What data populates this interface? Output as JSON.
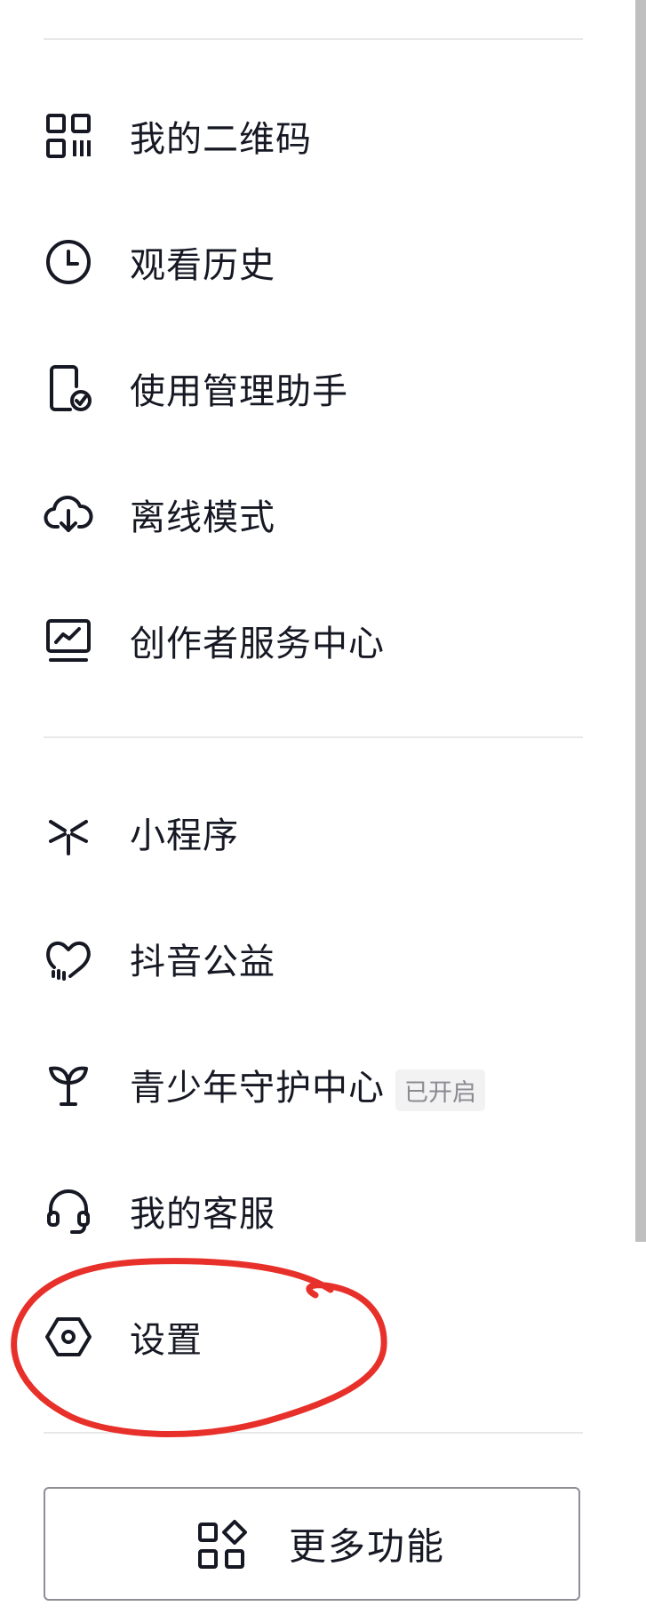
{
  "menu": {
    "items": [
      {
        "label": "我的二维码",
        "icon": "qr-code-icon"
      },
      {
        "label": "观看历史",
        "icon": "clock-icon"
      },
      {
        "label": "使用管理助手",
        "icon": "phone-check-icon"
      },
      {
        "label": "离线模式",
        "icon": "cloud-download-icon"
      },
      {
        "label": "创作者服务中心",
        "icon": "chart-monitor-icon"
      },
      {
        "label": "小程序",
        "icon": "mini-program-icon"
      },
      {
        "label": "抖音公益",
        "icon": "heart-icon"
      },
      {
        "label": "青少年守护中心",
        "icon": "sprout-icon",
        "badge": "已开启"
      },
      {
        "label": "我的客服",
        "icon": "headset-icon"
      },
      {
        "label": "设置",
        "icon": "hexagon-settings-icon"
      }
    ]
  },
  "more_button": {
    "label": "更多功能",
    "icon": "apps-grid-icon"
  },
  "colors": {
    "text": "#161823",
    "icon": "#161823",
    "divider": "#e8e8ea",
    "badge_bg": "#f2f2f3",
    "badge_text": "#8a8b91",
    "annotation": "#e8302a"
  }
}
